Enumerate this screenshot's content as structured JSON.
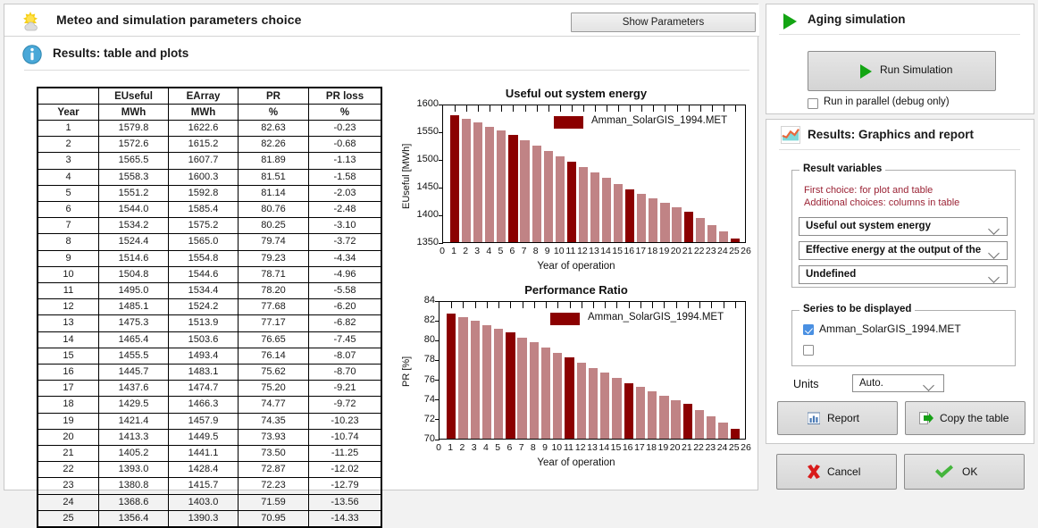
{
  "window": {
    "title": "Meteo and simulation parameters choice",
    "title_icon": "sun-cloud-icon",
    "show_parameters_label": "Show Parameters",
    "results_header": "Results:  table and plots",
    "results_icon": "info-icon"
  },
  "table": {
    "header_top": [
      "",
      "EUseful",
      "EArray",
      "PR",
      "PR loss"
    ],
    "header_units": [
      "Year",
      "MWh",
      "MWh",
      "%",
      "%"
    ],
    "rows": [
      [
        "1",
        "1579.8",
        "1622.6",
        "82.63",
        "-0.23"
      ],
      [
        "2",
        "1572.6",
        "1615.2",
        "82.26",
        "-0.68"
      ],
      [
        "3",
        "1565.5",
        "1607.7",
        "81.89",
        "-1.13"
      ],
      [
        "4",
        "1558.3",
        "1600.3",
        "81.51",
        "-1.58"
      ],
      [
        "5",
        "1551.2",
        "1592.8",
        "81.14",
        "-2.03"
      ],
      [
        "6",
        "1544.0",
        "1585.4",
        "80.76",
        "-2.48"
      ],
      [
        "7",
        "1534.2",
        "1575.2",
        "80.25",
        "-3.10"
      ],
      [
        "8",
        "1524.4",
        "1565.0",
        "79.74",
        "-3.72"
      ],
      [
        "9",
        "1514.6",
        "1554.8",
        "79.23",
        "-4.34"
      ],
      [
        "10",
        "1504.8",
        "1544.6",
        "78.71",
        "-4.96"
      ],
      [
        "11",
        "1495.0",
        "1534.4",
        "78.20",
        "-5.58"
      ],
      [
        "12",
        "1485.1",
        "1524.2",
        "77.68",
        "-6.20"
      ],
      [
        "13",
        "1475.3",
        "1513.9",
        "77.17",
        "-6.82"
      ],
      [
        "14",
        "1465.4",
        "1503.6",
        "76.65",
        "-7.45"
      ],
      [
        "15",
        "1455.5",
        "1493.4",
        "76.14",
        "-8.07"
      ],
      [
        "16",
        "1445.7",
        "1483.1",
        "75.62",
        "-8.70"
      ],
      [
        "17",
        "1437.6",
        "1474.7",
        "75.20",
        "-9.21"
      ],
      [
        "18",
        "1429.5",
        "1466.3",
        "74.77",
        "-9.72"
      ],
      [
        "19",
        "1421.4",
        "1457.9",
        "74.35",
        "-10.23"
      ],
      [
        "20",
        "1413.3",
        "1449.5",
        "73.93",
        "-10.74"
      ],
      [
        "21",
        "1405.2",
        "1441.1",
        "73.50",
        "-11.25"
      ],
      [
        "22",
        "1393.0",
        "1428.4",
        "72.87",
        "-12.02"
      ],
      [
        "23",
        "1380.8",
        "1415.7",
        "72.23",
        "-12.79"
      ],
      [
        "24",
        "1368.6",
        "1403.0",
        "71.59",
        "-13.56"
      ],
      [
        "25",
        "1356.4",
        "1390.3",
        "70.95",
        "-14.33"
      ]
    ]
  },
  "chart_data": [
    {
      "type": "bar",
      "title": "Useful out system energy",
      "xlabel": "Year of operation",
      "ylabel": "EUseful [MWh]",
      "ylim": [
        1350,
        1600
      ],
      "yticks": [
        1350,
        1400,
        1450,
        1500,
        1550,
        1600
      ],
      "xlim": [
        0,
        26
      ],
      "xticks": [
        0,
        1,
        2,
        3,
        4,
        5,
        6,
        7,
        8,
        9,
        10,
        11,
        12,
        13,
        14,
        15,
        16,
        17,
        18,
        19,
        20,
        21,
        22,
        23,
        24,
        25,
        26
      ],
      "categories": [
        1,
        2,
        3,
        4,
        5,
        6,
        7,
        8,
        9,
        10,
        11,
        12,
        13,
        14,
        15,
        16,
        17,
        18,
        19,
        20,
        21,
        22,
        23,
        24,
        25
      ],
      "values": [
        1579.8,
        1572.6,
        1565.5,
        1558.3,
        1551.2,
        1544.0,
        1534.2,
        1524.4,
        1514.6,
        1504.8,
        1495.0,
        1485.1,
        1475.3,
        1465.4,
        1455.5,
        1445.7,
        1437.6,
        1429.5,
        1421.4,
        1413.3,
        1405.2,
        1393.0,
        1380.8,
        1368.6,
        1356.4
      ],
      "highlight_years": [
        1,
        6,
        11,
        16,
        21,
        25
      ],
      "legend": [
        "Amman_SolarGIS_1994.MET"
      ],
      "legend_position": "top-right",
      "grid": false,
      "bar_color_dark": "#8B0000",
      "bar_color_light": "#C08385"
    },
    {
      "type": "bar",
      "title": "Performance Ratio",
      "xlabel": "Year of operation",
      "ylabel": "PR [%]",
      "ylim": [
        70,
        84
      ],
      "yticks": [
        70,
        72,
        74,
        76,
        78,
        80,
        82,
        84
      ],
      "xlim": [
        0,
        26
      ],
      "xticks": [
        0,
        1,
        2,
        3,
        4,
        5,
        6,
        7,
        8,
        9,
        10,
        11,
        12,
        13,
        14,
        15,
        16,
        17,
        18,
        19,
        20,
        21,
        22,
        23,
        24,
        25,
        26
      ],
      "categories": [
        1,
        2,
        3,
        4,
        5,
        6,
        7,
        8,
        9,
        10,
        11,
        12,
        13,
        14,
        15,
        16,
        17,
        18,
        19,
        20,
        21,
        22,
        23,
        24,
        25
      ],
      "values": [
        82.63,
        82.26,
        81.89,
        81.51,
        81.14,
        80.76,
        80.25,
        79.74,
        79.23,
        78.71,
        78.2,
        77.68,
        77.17,
        76.65,
        76.14,
        75.62,
        75.2,
        74.77,
        74.35,
        73.93,
        73.5,
        72.87,
        72.23,
        71.59,
        70.95
      ],
      "highlight_years": [
        1,
        6,
        11,
        16,
        21,
        25
      ],
      "legend": [
        "Amman_SolarGIS_1994.MET"
      ],
      "legend_position": "top-right",
      "grid": false,
      "bar_color_dark": "#8B0000",
      "bar_color_light": "#C08385"
    }
  ],
  "aging_panel": {
    "title": "Aging simulation",
    "icon": "play-triangle-icon",
    "run_button_label": "Run Simulation",
    "parallel_checkbox_label": "Run in parallel (debug only)",
    "parallel_checked": false
  },
  "graphics_panel": {
    "title": "Results: Graphics and report",
    "icon": "chart-area-icon",
    "result_variables": {
      "legend": "Result variables",
      "hint_line1": "First choice:   for plot and table",
      "hint_line2": "Additional  choices: columns in table",
      "hint_color": "#9b2335",
      "selects": [
        "Useful out system energy",
        "Effective energy at the output of the",
        "Undefined"
      ]
    },
    "series": {
      "legend": "Series to be displayed",
      "items": [
        {
          "label": "Amman_SolarGIS_1994.MET",
          "checked": true
        },
        {
          "label": "",
          "checked": false
        }
      ]
    },
    "units_label": "Units",
    "units_value": "Auto.",
    "report_button": "Report",
    "copy_button": "Copy the table"
  },
  "footer": {
    "cancel_label": "Cancel",
    "ok_label": "OK"
  }
}
